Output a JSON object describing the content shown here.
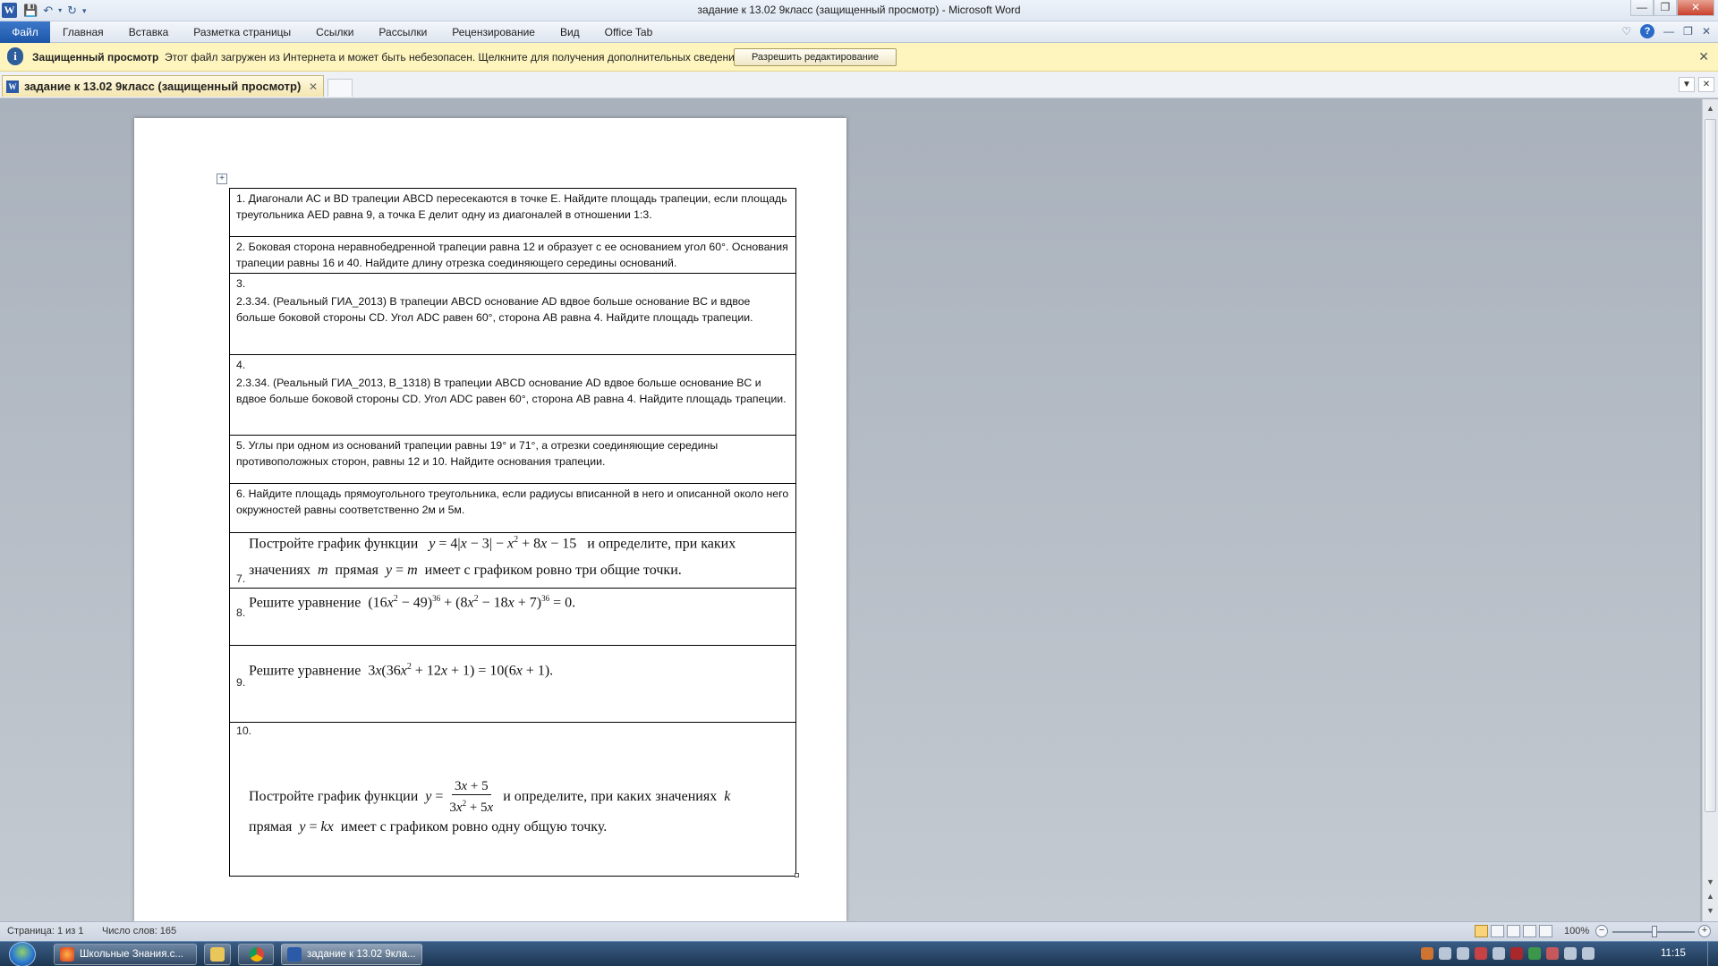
{
  "window": {
    "title": "задание к 13.02 9класс (защищенный просмотр)  -  Microsoft Word",
    "app_logo": "W"
  },
  "ribbon": {
    "file_tab": "Файл",
    "tabs": [
      "Главная",
      "Вставка",
      "Разметка страницы",
      "Ссылки",
      "Рассылки",
      "Рецензирование",
      "Вид",
      "Office Tab"
    ]
  },
  "infobar": {
    "title": "Защищенный просмотр",
    "message": "Этот файл загружен из Интернета и может быть небезопасен. Щелкните для получения дополнительных сведений.",
    "button": "Разрешить редактирование"
  },
  "doc_tab": {
    "label": "задание к 13.02 9класс (защищенный просмотр)"
  },
  "questions": {
    "q1": "1. Диагонали  AC  и  BD  трапеции ABCD  пересекаются в точке  E.  Найдите площадь трапеции, если площадь треугольника  AED  равна 9, а точка  E делит одну из диагоналей в отношении 1:3.",
    "q2": "2. Боковая сторона неравнобедренной трапеции равна 12 и образует с ее основанием угол 60°. Основания трапеции равны 16 и 40. Найдите длину отрезка соединяющего середины оснований.",
    "q3_num": "3.",
    "q3": " 2.3.34.  (Реальный ГИА_2013)  В трапеции ABCD основание AD вдвое больше основание BC и вдвое больше боковой стороны CD.  Угол ADC равен 60°, сторона AB равна 4.  Найдите площадь трапеции.",
    "q4_num": "4.",
    "q4": " 2.3.34.  (Реальный ГИА_2013, В_1318)  В трапеции ABCD основание AD вдвое больше основание BC и вдвое больше боковой стороны CD.  Угол ADC равен 60°, сторона AB равна 4. Найдите площадь трапеции.",
    "q5": "5. Углы при одном из оснований трапеции равны 19° и 71°, а отрезки соединяющие середины противоположных сторон, равны 12 и 10. Найдите основания трапеции.",
    "q6": "6. Найдите площадь прямоугольного треугольника, если радиусы вписанной в него и описанной около него окружностей  равны соответственно  2м и 5м.",
    "q7_num": "7.",
    "q7_line1_pre": "Постройте график функции",
    "q7_line1_post": "и определите, при каких",
    "q7_line2_pre": "значениях",
    "q7_line2_mid": "прямая",
    "q7_line2_post": "имеет с графиком ровно три общие точки.",
    "q8_num": "8.",
    "q8_pre": "Решите уравнение",
    "q9_num": "9.",
    "q9_pre": "Решите уравнение",
    "q10_num": "10.",
    "q10_line1_pre": "Постройте график функции",
    "q10_line1_post": "и определите, при каких  значениях",
    "q10_line2_pre": "прямая",
    "q10_line2_post": "имеет с графиком ровно одну общую точку."
  },
  "status": {
    "page": "Страница: 1 из 1",
    "words": "Число слов: 165",
    "zoom": "100%"
  },
  "taskbar": {
    "items": [
      "Школьные Знания.с...",
      "задание к 13.02 9кла..."
    ],
    "clock": "11:15"
  },
  "colors": {
    "file_tab": "#1d56a8",
    "infobar": "#fdf4be",
    "taskbar": "#1d3653"
  }
}
